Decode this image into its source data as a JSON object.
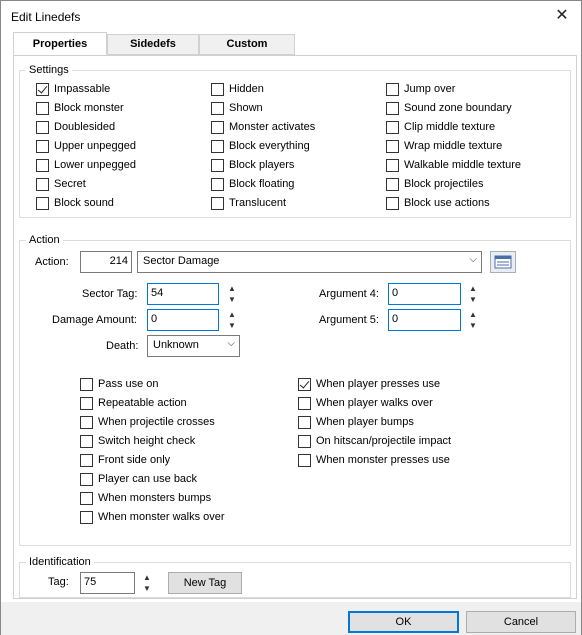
{
  "window": {
    "title": "Edit Linedefs"
  },
  "tabs": [
    {
      "label": "Properties"
    },
    {
      "label": "Sidedefs"
    },
    {
      "label": "Custom"
    }
  ],
  "settings": {
    "group_label": "Settings",
    "items": [
      {
        "label": "Impassable",
        "checked": true
      },
      {
        "label": "Block monster",
        "checked": false
      },
      {
        "label": "Doublesided",
        "checked": false
      },
      {
        "label": "Upper unpegged",
        "checked": false
      },
      {
        "label": "Lower unpegged",
        "checked": false
      },
      {
        "label": "Secret",
        "checked": false
      },
      {
        "label": "Block sound",
        "checked": false
      },
      {
        "label": "Hidden",
        "checked": false
      },
      {
        "label": "Shown",
        "checked": false
      },
      {
        "label": "Monster activates",
        "checked": false
      },
      {
        "label": "Block everything",
        "checked": false
      },
      {
        "label": "Block players",
        "checked": false
      },
      {
        "label": "Block floating",
        "checked": false
      },
      {
        "label": "Translucent",
        "checked": false
      },
      {
        "label": "Jump over",
        "checked": false
      },
      {
        "label": "Sound zone boundary",
        "checked": false
      },
      {
        "label": "Clip middle texture",
        "checked": false
      },
      {
        "label": "Wrap middle texture",
        "checked": false
      },
      {
        "label": "Walkable middle texture",
        "checked": false
      },
      {
        "label": "Block projectiles",
        "checked": false
      },
      {
        "label": "Block use actions",
        "checked": false
      }
    ]
  },
  "action": {
    "group_label": "Action",
    "action_label": "Action:",
    "action_number": "214",
    "action_name": "Sector Damage",
    "sector_tag_label": "Sector Tag:",
    "sector_tag_value": "54",
    "damage_amount_label": "Damage Amount:",
    "damage_amount_value": "0",
    "death_label": "Death:",
    "death_value": "Unknown",
    "arg4_label": "Argument 4:",
    "arg4_value": "0",
    "arg5_label": "Argument 5:",
    "arg5_value": "0",
    "flags": [
      {
        "label": "Pass use on",
        "checked": false
      },
      {
        "label": "Repeatable action",
        "checked": false
      },
      {
        "label": "When projectile crosses",
        "checked": false
      },
      {
        "label": "Switch height check",
        "checked": false
      },
      {
        "label": "Front side only",
        "checked": false
      },
      {
        "label": "Player can use back",
        "checked": false
      },
      {
        "label": "When monsters bumps",
        "checked": false
      },
      {
        "label": "When monster walks over",
        "checked": false
      },
      {
        "label": "When player presses use",
        "checked": true
      },
      {
        "label": "When player walks over",
        "checked": false
      },
      {
        "label": "When player bumps",
        "checked": false
      },
      {
        "label": "On hitscan/projectile impact",
        "checked": false
      },
      {
        "label": "When monster presses use",
        "checked": false
      }
    ]
  },
  "identification": {
    "group_label": "Identification",
    "tag_label": "Tag:",
    "tag_value": "75",
    "new_tag_label": "New Tag"
  },
  "footer": {
    "ok_label": "OK",
    "cancel_label": "Cancel"
  }
}
